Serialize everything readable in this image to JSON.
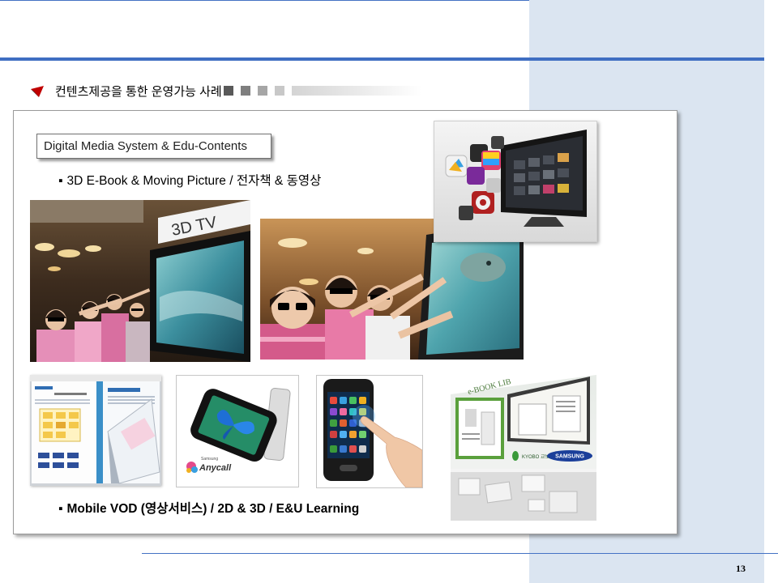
{
  "slide": {
    "heading": "컨텐츠제공을 통한 운영가능 사례",
    "label_box": "Digital Media System & Edu-Contents",
    "bullet_marker": "▪",
    "bullets": [
      "3D E-Book & Moving Picture / 전자책 & 동영상",
      "Mobile VOD (영상서비스) / 2D & 3D / E&U Learning"
    ],
    "page_number": "13"
  },
  "photos": {
    "tv_exhibition": {
      "sign_text": "3D TV"
    },
    "phone_butterfly": {
      "brand_small": "Samsung",
      "brand_logo": "Anycall"
    },
    "ebook_kiosk": {
      "header_text": "e-BOOK LIB",
      "partner_logo": "KYOBO 교보문고",
      "brand_logo": "SAMSUNG"
    }
  },
  "colors": {
    "accent_blue": "#4472C4",
    "side_panel": "#DBE5F1",
    "heading_arrow": "#C00000"
  },
  "icons": {
    "heading_bullet": "red-arrow-icon",
    "list_bullet": "square-bullet"
  }
}
